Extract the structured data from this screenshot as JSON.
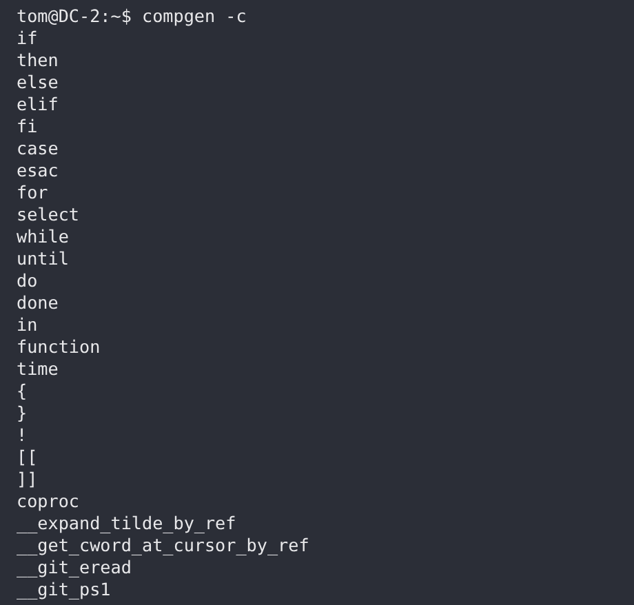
{
  "terminal": {
    "prompt": "tom@DC-2:~$ compgen -c",
    "lines": [
      "if",
      "then",
      "else",
      "elif",
      "fi",
      "case",
      "esac",
      "for",
      "select",
      "while",
      "until",
      "do",
      "done",
      "in",
      "function",
      "time",
      "{",
      "}",
      "!",
      "[[",
      "]]",
      "coproc",
      "__expand_tilde_by_ref",
      "__get_cword_at_cursor_by_ref",
      "__git_eread",
      "__git_ps1"
    ]
  }
}
